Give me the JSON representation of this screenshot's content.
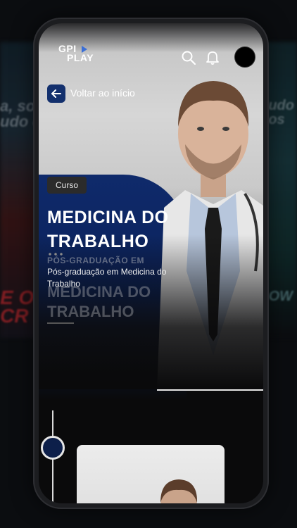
{
  "app": {
    "logo_line1": "GPI",
    "logo_line2": "PLAY"
  },
  "background": {
    "left_text": "a, so\nudo c",
    "right_text": "udo\nos",
    "left_bottom_text": "E OF\nCR",
    "right_bottom_text": "OW"
  },
  "nav": {
    "back_label": "Voltar ao início",
    "icons": [
      "search-icon",
      "bell-icon"
    ]
  },
  "hero": {
    "chip": "Curso",
    "title": "MEDICINA DO TRABALHO",
    "subtitle": "Pós-graduação em Medicina do Trabalho",
    "ghost_small": "PÓS-GRADUAÇÃO EM",
    "ghost_title": "MEDICINA DO TRABALHO"
  },
  "colors": {
    "accent": "#13306d",
    "hero_blue": "#0f2a6b",
    "background": "#0b0d10"
  }
}
